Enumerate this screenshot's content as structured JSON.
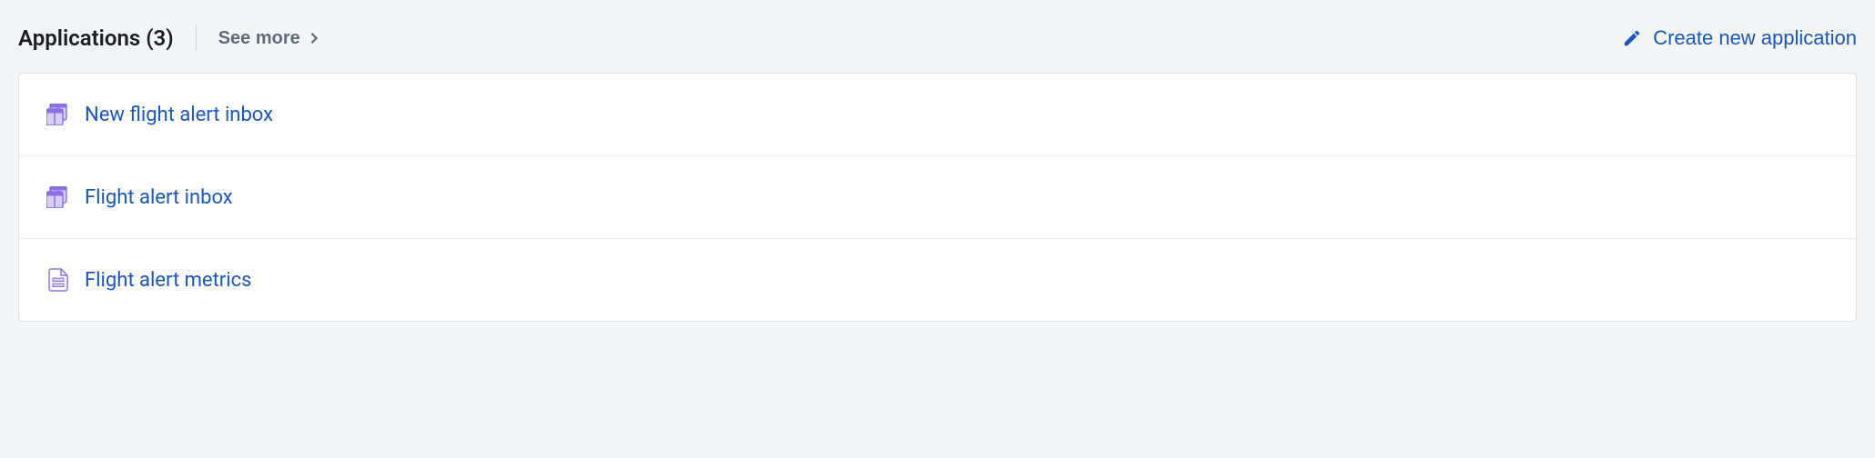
{
  "header": {
    "title": "Applications (3)",
    "see_more_label": "See more",
    "create_label": "Create new application"
  },
  "applications": {
    "items": [
      {
        "name": "New flight alert inbox",
        "icon": "workshop"
      },
      {
        "name": "Flight alert inbox",
        "icon": "workshop"
      },
      {
        "name": "Flight alert metrics",
        "icon": "document"
      }
    ]
  },
  "colors": {
    "link": "#1a56c4",
    "icon_purple": "#8a6fe6",
    "icon_purple_light": "#d8cdf5",
    "muted": "#5e6b7a"
  }
}
